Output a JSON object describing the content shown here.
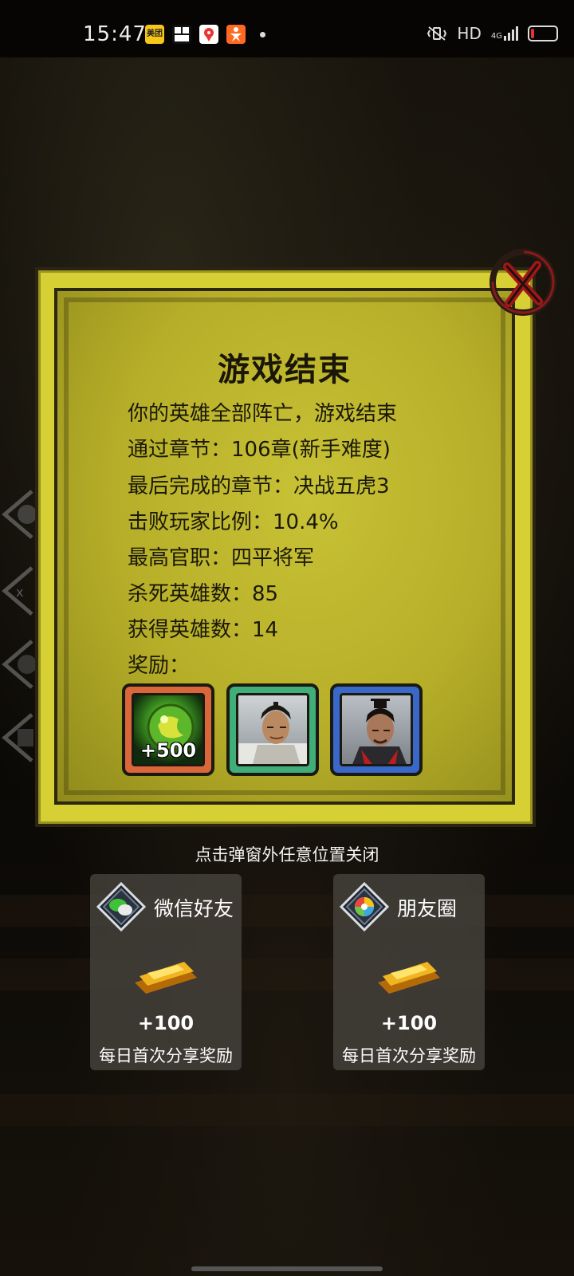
{
  "status_bar": {
    "time": "15:47",
    "apps": [
      {
        "icon": "meituan-app-icon",
        "text": "美团",
        "color": "#f6c619"
      },
      {
        "icon": "grid-app-icon",
        "text": "",
        "color": "#ffffff"
      },
      {
        "icon": "map-pin-app-icon",
        "text": "",
        "color": "#ffffff"
      },
      {
        "icon": "person-app-icon",
        "text": "",
        "color": "#ff6a22"
      }
    ],
    "network": "HD",
    "signal": "4G",
    "battery_level": 0.15,
    "battery_color": "#e33333"
  },
  "dialog": {
    "title": "游戏结束",
    "lines": [
      "你的英雄全部阵亡，游戏结束",
      "通过章节：106章(新手难度)",
      "最后完成的章节：决战五虎3",
      "击败玩家比例：10.4%",
      "最高官职：四平将军",
      "杀死英雄数：85",
      "获得英雄数：14",
      "奖励："
    ],
    "rewards": [
      {
        "icon": "green-jade-orb-icon",
        "amount": "+500",
        "frame_color": "#d9673a",
        "name": ""
      },
      {
        "icon": "hero-portrait-warrior-icon",
        "amount": "",
        "frame_color": "#3fae78",
        "name": ""
      },
      {
        "icon": "hero-portrait-general-icon",
        "amount": "",
        "frame_color": "#3a68c8",
        "name": ""
      }
    ],
    "panel_color": "#d6d035",
    "close_icon": "red-x-close-icon"
  },
  "hint": "点击弹窗外任意位置关闭",
  "share": [
    {
      "icon": "wechat-icon",
      "label": "微信好友",
      "reward_icon": "gold-ingot-icon",
      "amount": "+100",
      "desc": "每日首次分享奖励"
    },
    {
      "icon": "moments-icon",
      "label": "朋友圈",
      "reward_icon": "gold-ingot-icon",
      "amount": "+100",
      "desc": "每日首次分享奖励"
    }
  ]
}
